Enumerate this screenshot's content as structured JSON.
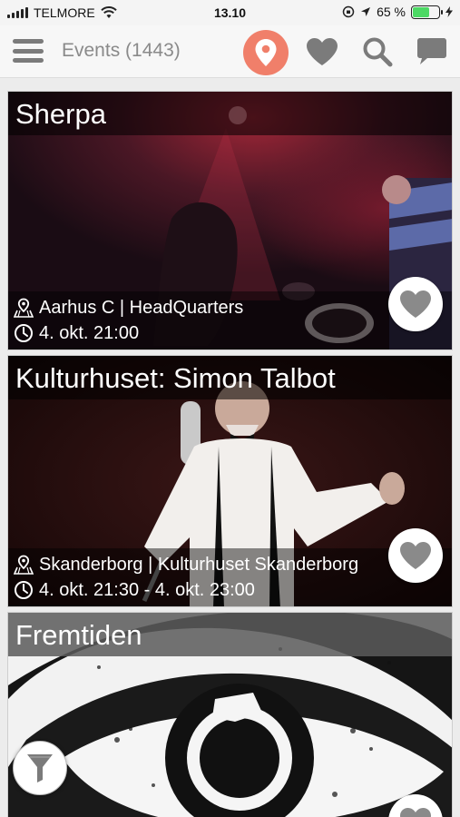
{
  "status": {
    "carrier": "TELMORE",
    "time": "13.10",
    "battery": "65 %",
    "battery_level": 0.65
  },
  "header": {
    "title": "Events (1443)",
    "menu_icon": "hamburger-menu-icon",
    "location_icon": "map-pin-icon",
    "favorites_icon": "heart-icon",
    "search_icon": "search-icon",
    "chat_icon": "chat-bubble-icon",
    "accent_color": "#f07f6a"
  },
  "events": [
    {
      "title": "Sherpa",
      "location": "Aarhus C | HeadQuarters",
      "time": "4. okt. 21:00"
    },
    {
      "title": "Kulturhuset: Simon Talbot",
      "location": "Skanderborg | Kulturhuset Skanderborg",
      "time": "4. okt. 21:30 - 4. okt. 23:00"
    },
    {
      "title": "Fremtiden"
    }
  ],
  "filter": {
    "icon": "funnel-filter-icon"
  }
}
